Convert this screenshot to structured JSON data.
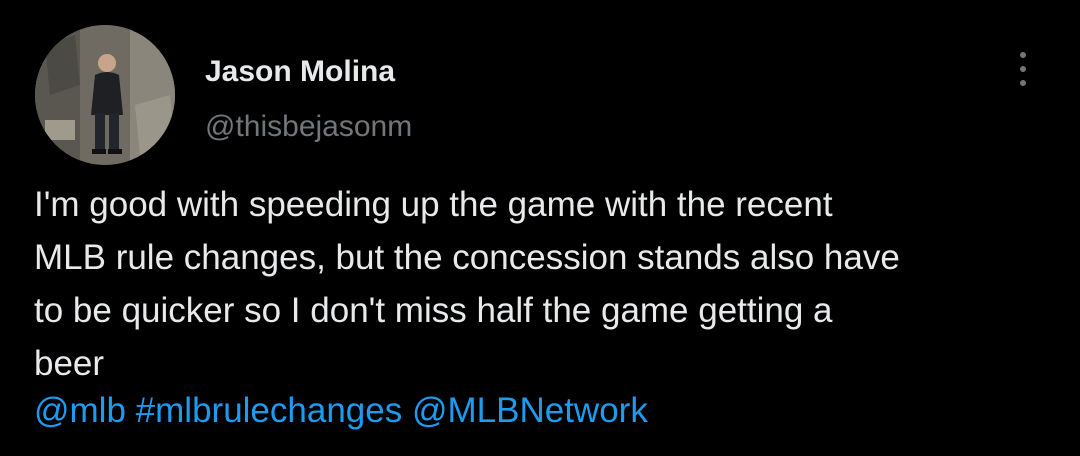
{
  "author": {
    "name": "Jason Molina",
    "handle": "@thisbejasonm"
  },
  "tweet": {
    "lines": [
      "I'm good with speeding up the game with the recent",
      "MLB rule changes, but the concession stands also have",
      "to be quicker so I don't miss half the game getting a",
      "beer"
    ],
    "mentions": {
      "mlb": "@mlb",
      "hashtag": "#mlbrulechanges",
      "network": "@MLBNetwork"
    }
  },
  "colors": {
    "background": "#000000",
    "text": "#e7e9ea",
    "secondary": "#71767b",
    "link": "#1d9bf0"
  },
  "icons": {
    "more": "more-vertical-icon"
  }
}
